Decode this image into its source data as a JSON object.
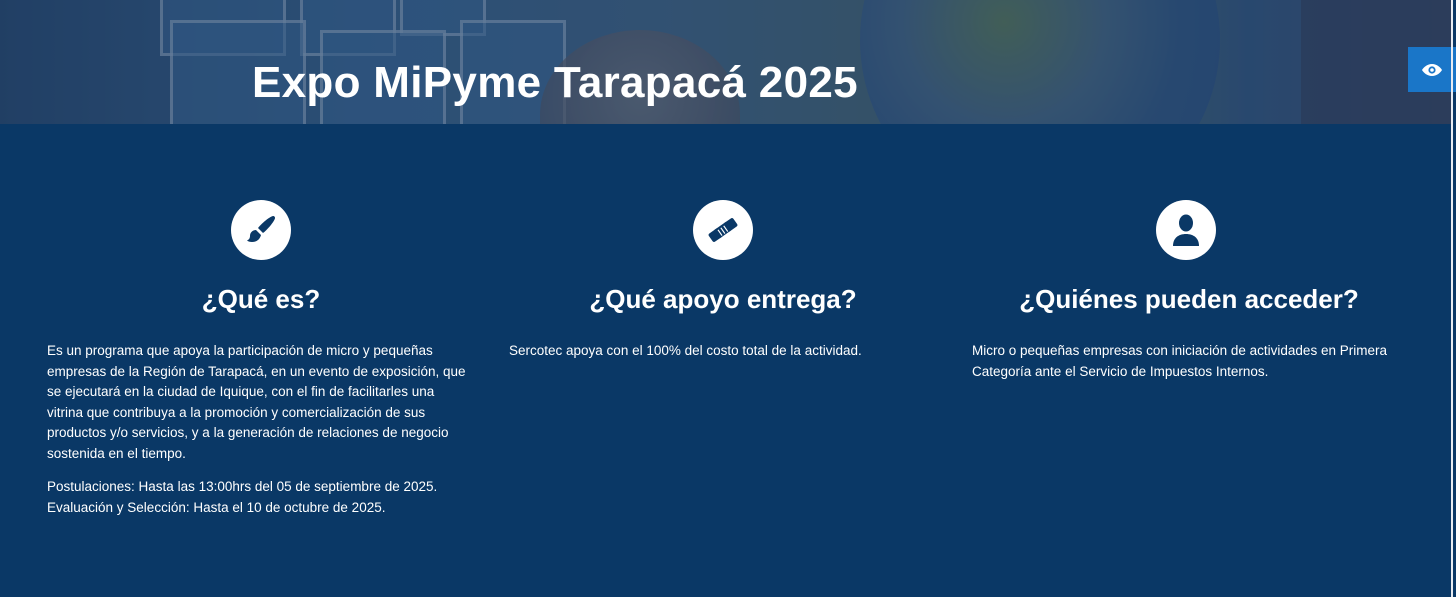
{
  "hero": {
    "title": "Expo MiPyme Tarapacá 2025"
  },
  "accessibility": {
    "icon": "eye-icon",
    "color": "#1a76c8"
  },
  "colors": {
    "background": "#0a3866",
    "text": "#ffffff"
  },
  "columns": [
    {
      "icon": "paintbrush-icon",
      "title": "¿Qué es?",
      "paragraphs": [
        "Es un programa que apoya la participación de micro y pequeñas empresas de la Región de Tarapacá, en un evento de exposición, que se ejecutará en la ciudad de Iquique, con el fin de facilitarles una vitrina que contribuya a la promoción y comercialización de sus productos y/o servicios, y a la generación de relaciones de negocio sostenida en el tiempo.",
        "Postulaciones: Hasta las 13:00hrs del 05 de septiembre de 2025.",
        "Evaluación y Selección: Hasta el 10 de octubre de 2025."
      ]
    },
    {
      "icon": "handshake-icon",
      "title": "¿Qué apoyo entrega?",
      "paragraphs": [
        "Sercotec apoya con el 100% del costo total de la actividad."
      ]
    },
    {
      "icon": "user-icon",
      "title": "¿Quiénes pueden acceder?",
      "paragraphs": [
        "Micro o pequeñas empresas con iniciación de actividades en Primera Categoría ante el Servicio de Impuestos Internos."
      ]
    }
  ]
}
